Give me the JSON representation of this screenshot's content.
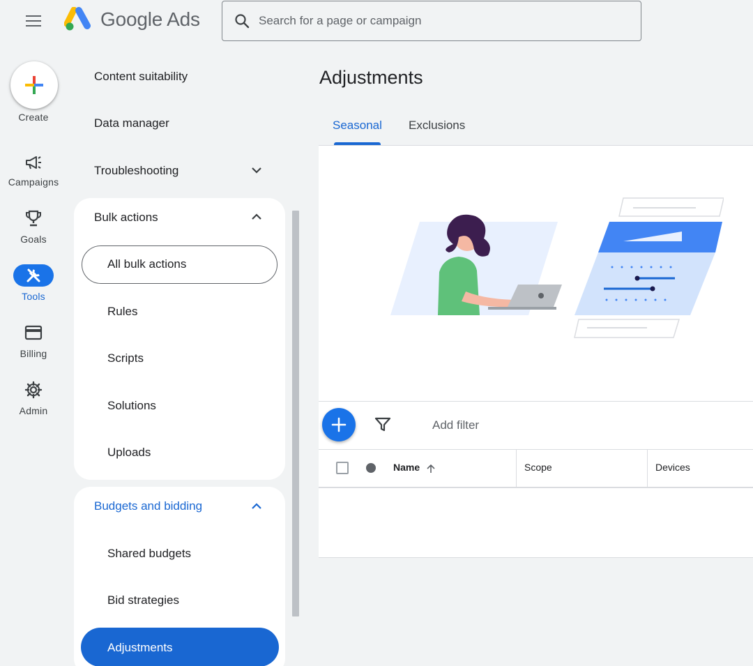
{
  "header": {
    "logo_text": "Google Ads",
    "search_placeholder": "Search for a page or campaign"
  },
  "rail": {
    "create_label": "Create",
    "items": [
      {
        "label": "Campaigns",
        "icon": "megaphone-icon"
      },
      {
        "label": "Goals",
        "icon": "trophy-icon"
      },
      {
        "label": "Tools",
        "icon": "tools-icon",
        "active": true
      },
      {
        "label": "Billing",
        "icon": "credit-card-icon"
      },
      {
        "label": "Admin",
        "icon": "gear-icon"
      }
    ]
  },
  "nav": {
    "content_suitability": "Content suitability",
    "data_manager": "Data manager",
    "troubleshooting": "Troubleshooting",
    "bulk_actions": {
      "label": "Bulk actions",
      "items": [
        "All bulk actions",
        "Rules",
        "Scripts",
        "Solutions",
        "Uploads"
      ]
    },
    "budgets_and_bidding": {
      "label": "Budgets and bidding",
      "items": [
        "Shared budgets",
        "Bid strategies",
        "Adjustments"
      ]
    }
  },
  "main": {
    "title": "Adjustments",
    "tabs": [
      {
        "label": "Seasonal",
        "active": true
      },
      {
        "label": "Exclusions",
        "active": false
      }
    ],
    "add_filter": "Add filter",
    "table": {
      "columns": [
        "Name",
        "Scope",
        "Devices"
      ]
    }
  },
  "colors": {
    "accent": "#1a73e8",
    "accent_dark": "#1967d2",
    "background": "#f1f3f4"
  }
}
